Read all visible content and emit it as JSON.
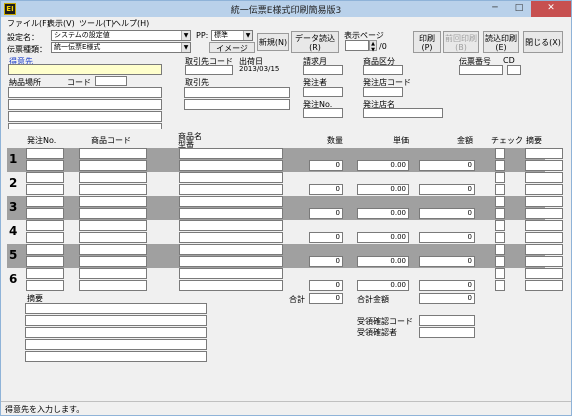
{
  "window": {
    "title": "統一伝票E様式印刷簡易版3",
    "icon_text": "EI",
    "minimize": "─",
    "maximize": "□",
    "close": "✕"
  },
  "menu": [
    "ファイル(F)",
    "表示(V)",
    "ツール(T)",
    "ヘルプ(H)"
  ],
  "toolbar": {
    "settings_label": "設定名：",
    "settings_value": "システムの設定値",
    "slip_type_label": "伝票種類：",
    "slip_type_value": "統一伝票E様式",
    "pp_label": "PP:",
    "pp_value": "標準",
    "image_button": "イメージ",
    "new_button": "新規(N)",
    "load_button_line1": "データ読込",
    "load_button_line2": "(R)",
    "page_label": "表示ページ",
    "page_total": "/0",
    "print_line1": "印刷",
    "print_line2": "(P)",
    "reprint_line1": "前回印刷",
    "reprint_line2": "(B)",
    "readprint_line1": "読込印刷",
    "readprint_line2": "(E)",
    "close_button": "閉じる(X)"
  },
  "header": {
    "customer_label": "得意先",
    "supplier_code_label": "取引先コード",
    "ship_date_label": "出荷日",
    "ship_date_value": "2013/03/15",
    "billing_month_label": "請求月",
    "product_class_label": "商品区分",
    "slip_number_label": "伝票番号",
    "cd_label": "CD",
    "delivery_place_label": "納品場所",
    "code_label": "コード",
    "supplier_label": "取引先",
    "orderer_label": "発注者",
    "order_no_label": "発注No.",
    "store_code_label": "発注店コード",
    "store_name_label": "発注店名"
  },
  "table": {
    "headers": {
      "order_no": "発注No.",
      "product_code": "商品コード",
      "product_name_1": "商品名",
      "product_name_2": "型番",
      "quantity": "数量",
      "unit_price": "単価",
      "amount": "金額",
      "check": "チェック",
      "remarks": "摘要"
    },
    "rows": [
      {
        "num": "1",
        "qty": "0",
        "price": "0.00",
        "amount": "0"
      },
      {
        "num": "2",
        "qty": "0",
        "price": "0.00",
        "amount": "0"
      },
      {
        "num": "3",
        "qty": "0",
        "price": "0.00",
        "amount": "0"
      },
      {
        "num": "4",
        "qty": "0",
        "price": "0.00",
        "amount": "0"
      },
      {
        "num": "5",
        "qty": "0",
        "price": "0.00",
        "amount": "0"
      },
      {
        "num": "6",
        "qty": "0",
        "price": "0.00",
        "amount": "0"
      }
    ]
  },
  "footer": {
    "remarks_label": "摘要",
    "total_label": "合計",
    "total_qty": "0",
    "total_amount_label": "合計金額",
    "total_amount": "0",
    "receipt_code_label": "受領確認コード",
    "receipt_person_label": "受領確認者"
  },
  "status": "得意先を入力します。"
}
